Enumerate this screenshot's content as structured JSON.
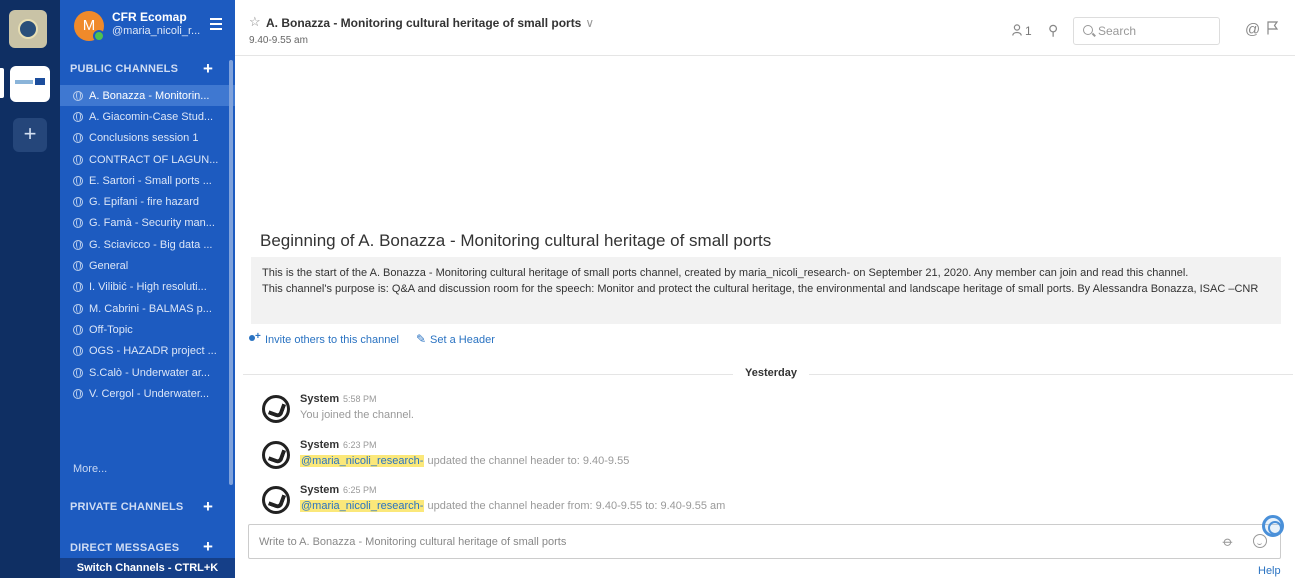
{
  "team": {
    "add_label": "+"
  },
  "sidebar": {
    "team_name": "CFR Ecomap",
    "user_name": "@maria_nicoli_r...",
    "avatar_letter": "M",
    "public_label": "PUBLIC CHANNELS",
    "private_label": "PRIVATE CHANNELS",
    "direct_label": "DIRECT MESSAGES",
    "add_symbol": "+",
    "more_label": "More...",
    "switch_label": "Switch Channels - CTRL+K",
    "channels": [
      {
        "name": "A. Bonazza - Monitorin...",
        "active": true
      },
      {
        "name": "A. Giacomin-Case Stud...",
        "active": false
      },
      {
        "name": "Conclusions session 1",
        "active": false
      },
      {
        "name": "CONTRACT OF LAGUN...",
        "active": false
      },
      {
        "name": "E. Sartori - Small ports ...",
        "active": false
      },
      {
        "name": "G. Epifani - fire hazard",
        "active": false
      },
      {
        "name": "G. Famà - Security man...",
        "active": false
      },
      {
        "name": "G. Sciavicco - Big data ...",
        "active": false
      },
      {
        "name": "General",
        "active": false
      },
      {
        "name": "I. Vilibić - High resoluti...",
        "active": false
      },
      {
        "name": "M. Cabrini - BALMAS p...",
        "active": false
      },
      {
        "name": "Off-Topic",
        "active": false
      },
      {
        "name": "OGS - HAZADR project ...",
        "active": false
      },
      {
        "name": "S.Calò - Underwater ar...",
        "active": false
      },
      {
        "name": "V. Cergol - Underwater...",
        "active": false
      }
    ]
  },
  "header": {
    "star_icon": "☆",
    "title": "A. Bonazza - Monitoring cultural heritage of small ports",
    "caret": "∨",
    "subtitle": "9.40-9.55 am",
    "member_count": "1",
    "pin_icon": "⚲",
    "search_placeholder": "Search",
    "at_icon": "@"
  },
  "intro": {
    "title": "Beginning of A. Bonazza - Monitoring cultural heritage of small ports",
    "line1": "This is the start of the A. Bonazza - Monitoring cultural heritage of small ports channel, created by maria_nicoli_research- on September 21, 2020. Any member can join and read this channel.",
    "line2": "This channel's purpose is: Q&A and discussion room for the speech: Monitor and protect the cultural heritage, the environmental and landscape heritage of small ports. By Alessandra Bonazza, ISAC –CNR",
    "invite_label": "Invite others to this channel",
    "header_label": "Set a Header",
    "pencil_icon": "✎"
  },
  "date_separator": "Yesterday",
  "posts": [
    {
      "user": "System",
      "time": "5:58 PM",
      "mention": "",
      "text": "You joined the channel."
    },
    {
      "user": "System",
      "time": "6:23 PM",
      "mention": "@maria_nicoli_research-",
      "text": " updated the channel header to: 9.40-9.55"
    },
    {
      "user": "System",
      "time": "6:25 PM",
      "mention": "@maria_nicoli_research-",
      "text": " updated the channel header from: 9.40-9.55 to: 9.40-9.55 am"
    }
  ],
  "composer": {
    "placeholder": "Write to A. Bonazza - Monitoring cultural heritage of small ports",
    "attach_icon": "⌀"
  },
  "help_label": "Help",
  "colors": {
    "team_bar": "#0f2f63",
    "sidebar": "#1d5bc0",
    "active_channel": "#3f78d1",
    "link": "#2a73c2",
    "mention_highlight": "#fbe87a"
  }
}
